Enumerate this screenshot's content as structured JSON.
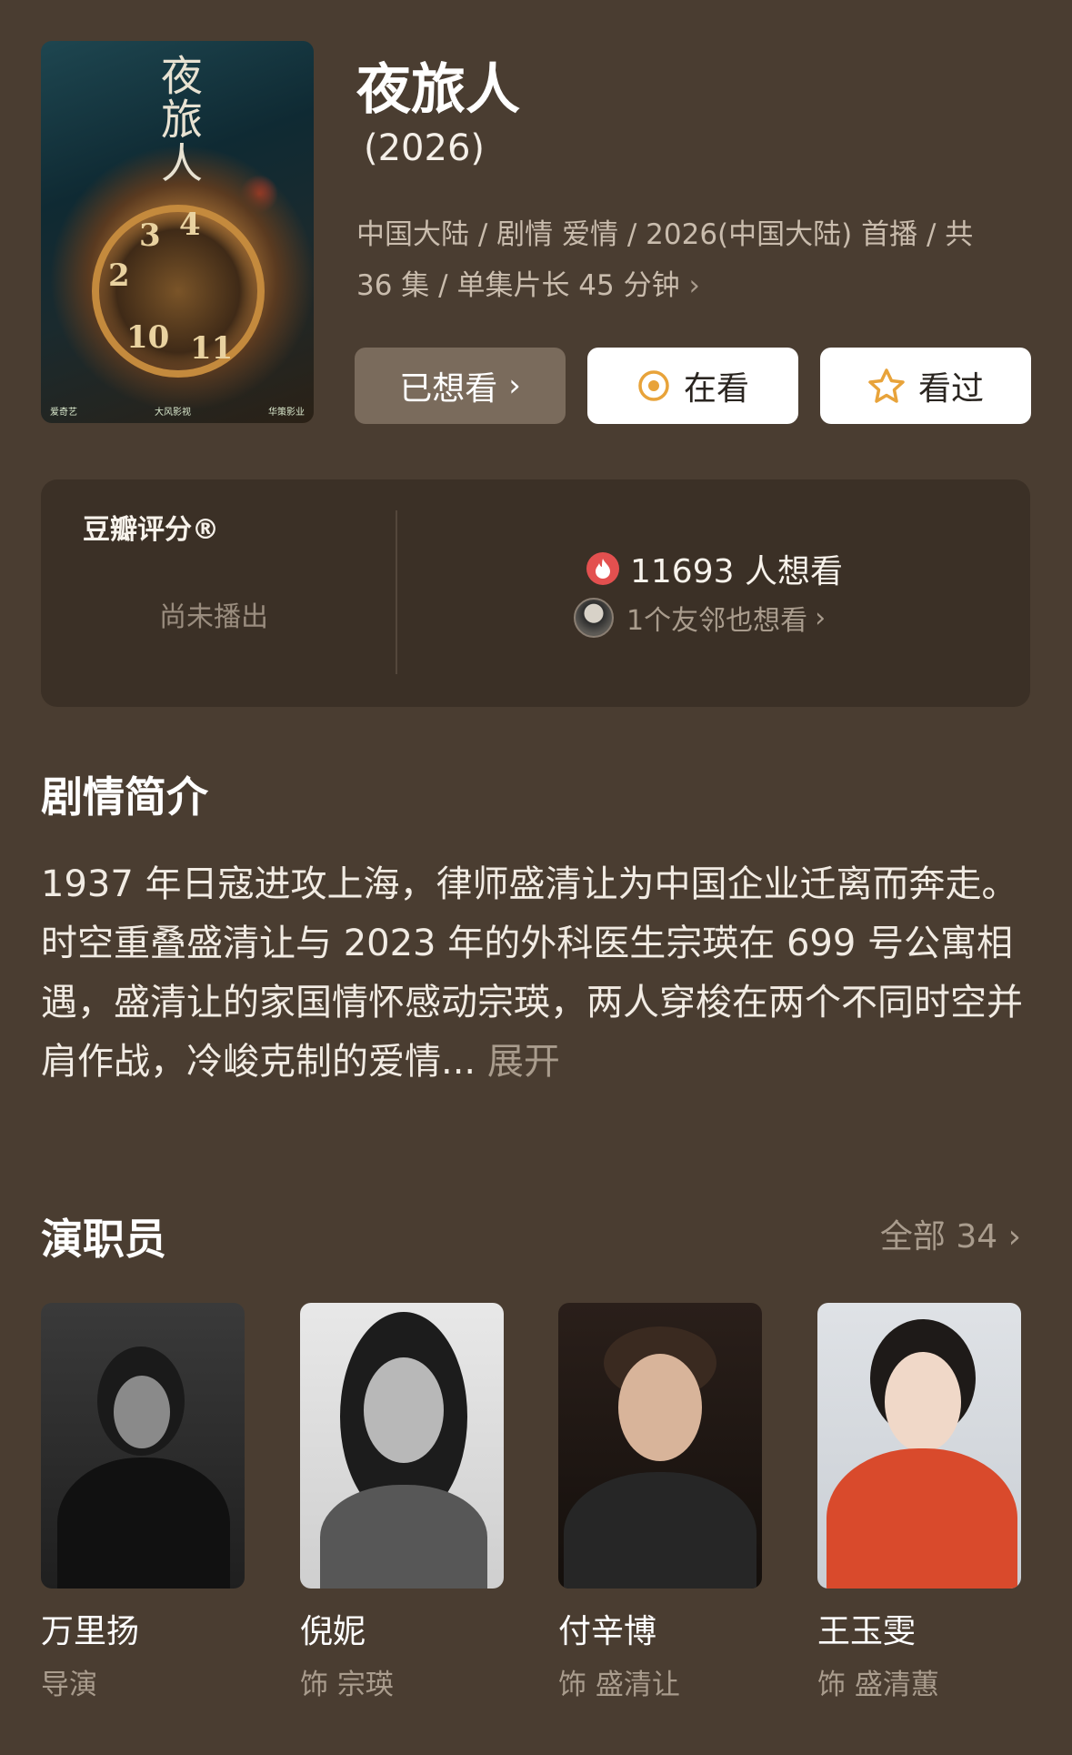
{
  "poster": {
    "title_art": "夜旅人",
    "clock_numerals": [
      "2",
      "3",
      "4",
      "10",
      "11"
    ],
    "logos": [
      "爱奇艺",
      "大风影视",
      "华策影业"
    ]
  },
  "header": {
    "title": "夜旅人",
    "year": "(2026)",
    "meta_line1": "中国大陆 / 剧情 爱情 / 2026(中国大陆) 首播 / 共",
    "meta_line2": "36 集 / 单集片长 45 分钟",
    "meta_chevron": "›"
  },
  "actions": {
    "wanted_label": "已想看",
    "wanted_chevron": "›",
    "watching_label": "在看",
    "watched_label": "看过"
  },
  "rating": {
    "label": "豆瓣评分®",
    "status": "尚未播出",
    "want_count": "11693 人想看",
    "friends_text": "1个友邻也想看",
    "friends_chevron": "›"
  },
  "synopsis": {
    "heading": "剧情简介",
    "text": "1937 年日寇进攻上海，律师盛清让为中国企业迁离而奔走。时空重叠盛清让与 2023 年的外科医生宗瑛在 699 号公寓相遇，盛清让的家国情怀感动宗瑛，两人穿梭在两个不同时空并肩作战，冷峻克制的爱情...",
    "expand": "展开"
  },
  "cast": {
    "heading": "演职员",
    "all_label": "全部 34 ›",
    "members": [
      {
        "name": "万里扬",
        "role": "导演"
      },
      {
        "name": "倪妮",
        "role": "饰 宗瑛"
      },
      {
        "name": "付辛博",
        "role": "饰 盛清让"
      },
      {
        "name": "王玉雯",
        "role": "饰 盛清蕙"
      }
    ]
  },
  "colors": {
    "background": "#4a3d31",
    "card": "#3b3026",
    "muted_text": "#a99c8d",
    "fire": "#e3504f",
    "watching_icon": "#e8a33a",
    "star_icon": "#e8a33a"
  }
}
